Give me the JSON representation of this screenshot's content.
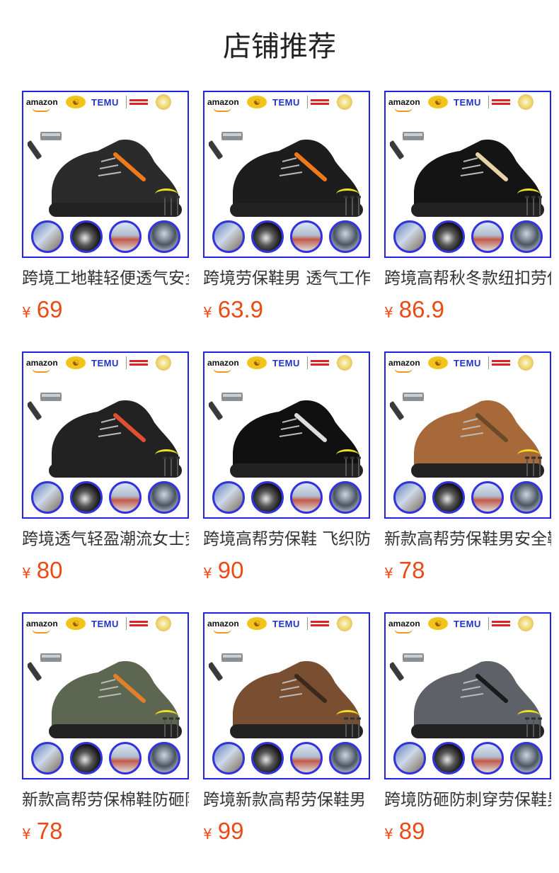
{
  "page": {
    "title": "店铺推荐"
  },
  "banner": {
    "amazon_label": "amazon",
    "temu_label": "TEMU"
  },
  "colors": {
    "price": "#ec4a14",
    "frame": "#2222e6",
    "title": "#222222"
  },
  "products": [
    {
      "name": "跨境工地鞋轻便透气安全鞋",
      "currency": "¥",
      "price": "69",
      "shoe_color": "#2b2b2b",
      "accent": "#f07a1a"
    },
    {
      "name": "跨境劳保鞋男 透气工作鞋",
      "currency": "¥",
      "price": "63.9",
      "shoe_color": "#1d1d1d",
      "accent": "#f07a1a"
    },
    {
      "name": "跨境高帮秋冬款纽扣劳保鞋",
      "currency": "¥",
      "price": "86.9",
      "shoe_color": "#141414",
      "accent": "#e8d2a8"
    },
    {
      "name": "跨境透气轻盈潮流女士劳保鞋",
      "currency": "¥",
      "price": "80",
      "shoe_color": "#222222",
      "accent": "#e05030"
    },
    {
      "name": "跨境高帮劳保鞋 飞织防砸",
      "currency": "¥",
      "price": "90",
      "shoe_color": "#101010",
      "accent": "#dddddd"
    },
    {
      "name": "新款高帮劳保鞋男安全鞋",
      "currency": "¥",
      "price": "78",
      "shoe_color": "#a8693a",
      "accent": "#6b4a2a"
    },
    {
      "name": "新款高帮劳保棉鞋防砸防刺",
      "currency": "¥",
      "price": "78",
      "shoe_color": "#5c6650",
      "accent": "#e0802a"
    },
    {
      "name": "跨境新款高帮劳保鞋男",
      "currency": "¥",
      "price": "99",
      "shoe_color": "#7a4e30",
      "accent": "#3a2a1e"
    },
    {
      "name": "跨境防砸防刺穿劳保鞋男",
      "currency": "¥",
      "price": "89",
      "shoe_color": "#5e6268",
      "accent": "#1a1a1a"
    }
  ]
}
